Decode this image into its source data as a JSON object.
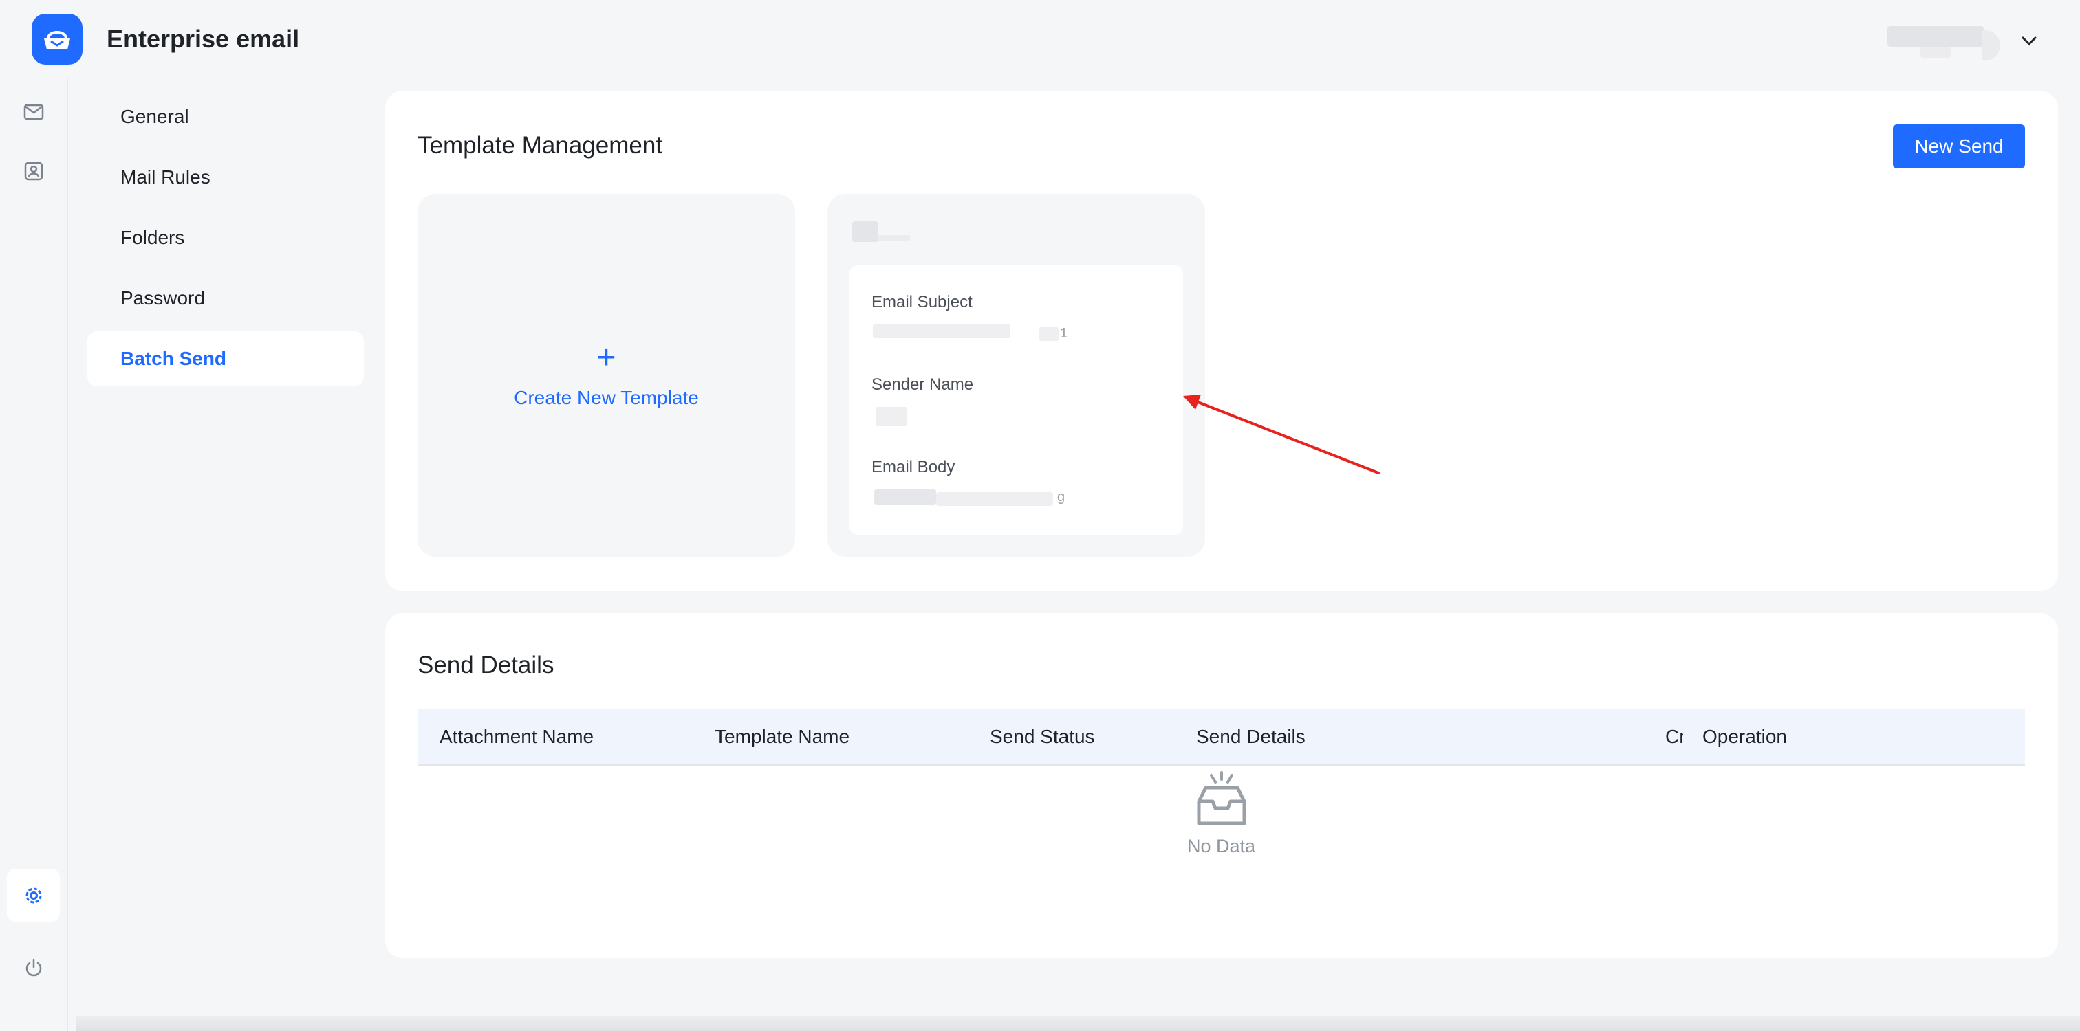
{
  "header": {
    "app_title": "Enterprise email",
    "logo_icon": "mailbox-icon",
    "user_menu_icon": "chevron-down-icon"
  },
  "rail": {
    "items": [
      {
        "icon": "mail-icon",
        "active": false
      },
      {
        "icon": "contacts-icon",
        "active": false
      },
      {
        "icon": "settings-gear-icon",
        "active": true
      },
      {
        "icon": "power-icon",
        "active": false
      }
    ]
  },
  "nav": {
    "items": [
      {
        "label": "General",
        "active": false
      },
      {
        "label": "Mail Rules",
        "active": false
      },
      {
        "label": "Folders",
        "active": false
      },
      {
        "label": "Password",
        "active": false
      },
      {
        "label": "Batch Send",
        "active": true
      }
    ]
  },
  "templates": {
    "title": "Template Management",
    "new_send_label": "New Send",
    "create_label": "Create New Template",
    "create_icon": "+",
    "card": {
      "subject_label": "Email Subject",
      "subject_tail": "1",
      "sender_label": "Sender Name",
      "body_label": "Email Body",
      "body_tail": "g"
    }
  },
  "send_details": {
    "title": "Send Details",
    "columns": [
      "Attachment Name",
      "Template Name",
      "Send Status",
      "Send Details",
      "Cr",
      "Operation"
    ],
    "empty_text": "No Data",
    "empty_icon": "empty-inbox-icon"
  },
  "colors": {
    "accent": "#1f6bff",
    "annotation_arrow": "#e8231d",
    "background": "#f5f6f8",
    "table_header": "#f0f4fc"
  }
}
